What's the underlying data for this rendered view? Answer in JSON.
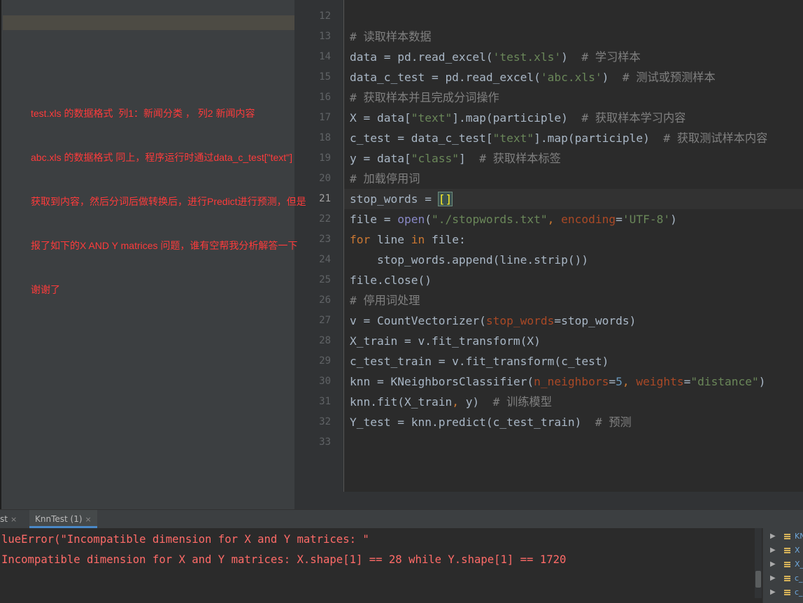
{
  "annotation": {
    "lines": [
      "test.xls 的数据格式  列1：新闻分类 ， 列2 新闻内容",
      "abc.xls 的数据格式 同上，程序运行时通过data_c_test[\"text\"]",
      "获取到内容，然后分词后做转换后，进行Predict进行预测，但是",
      "报了如下的X AND Y matrices 问题，谁有空帮我分析解答一下",
      "谢谢了"
    ]
  },
  "editor": {
    "line_numbers": [
      "12",
      "13",
      "14",
      "15",
      "16",
      "17",
      "18",
      "19",
      "20",
      "21",
      "22",
      "23",
      "24",
      "25",
      "26",
      "27",
      "28",
      "29",
      "30",
      "31",
      "32",
      "33"
    ],
    "current_line": "21",
    "code": {
      "l13": "# 读取样本数据",
      "l14_a": "data = pd.read_excel(",
      "l14_s": "'test.xls'",
      "l14_b": ")  ",
      "l14_c": "# 学习样本",
      "l15_a": "data_c_test = pd.read_excel(",
      "l15_s": "'abc.xls'",
      "l15_b": ")  ",
      "l15_c": "# 测试或预测样本",
      "l16": "# 获取样本并且完成分词操作",
      "l17_a": "X = data[",
      "l17_s": "\"text\"",
      "l17_b": "].map(participle)  ",
      "l17_c": "# 获取样本学习内容",
      "l18_a": "c_test = data_c_test[",
      "l18_s": "\"text\"",
      "l18_b": "].map(participle)  ",
      "l18_c": "# 获取测试样本内容",
      "l19_a": "y = data[",
      "l19_s": "\"class\"",
      "l19_b": "]  ",
      "l19_c": "# 获取样本标签",
      "l20": "# 加载停用词",
      "l21_a": "stop_words = ",
      "l21_br": "[]",
      "l22_a": "file = ",
      "l22_fn": "open",
      "l22_b": "(",
      "l22_s1": "\"./stopwords.txt\"",
      "l22_k": ", ",
      "l22_p": "encoding",
      "l22_eq": "=",
      "l22_s2": "'UTF-8'",
      "l22_c": ")",
      "l23_k1": "for",
      "l23_a": " line ",
      "l23_k2": "in",
      "l23_b": " file:",
      "l24": "    stop_words.append(line.strip())",
      "l25": "file.close()",
      "l26": "# 停用词处理",
      "l27_a": "v = CountVectorizer(",
      "l27_p": "stop_words",
      "l27_b": "=stop_words)",
      "l28": "X_train = v.fit_transform(X)",
      "l29": "c_test_train = v.fit_transform(c_test)",
      "l30_a": "knn = KNeighborsClassifier(",
      "l30_p1": "n_neighbors",
      "l30_eq1": "=",
      "l30_n": "5",
      "l30_k": ", ",
      "l30_p2": "weights",
      "l30_eq2": "=",
      "l30_s": "\"distance\"",
      "l30_b": ")",
      "l31_a": "knn.fit(X_train",
      "l31_k": ", ",
      "l31_b": "y)  ",
      "l31_c": "# 训练模型",
      "l32_a": "Y_test = knn.predict(c_test_train)  ",
      "l32_c": "# 预测"
    }
  },
  "run_panel": {
    "tabs": [
      {
        "label": "st",
        "close": "×"
      },
      {
        "label": "KnnTest (1)",
        "close": "×"
      }
    ],
    "output": [
      "lueError(\"Incompatible dimension for X and Y matrices: \"",
      "Incompatible dimension for X and Y matrices: X.shape[1] == 28 while Y.shape[1] == 1720"
    ]
  },
  "variables": {
    "items": [
      "KN",
      "X",
      "X_",
      "c_",
      "c_"
    ]
  }
}
